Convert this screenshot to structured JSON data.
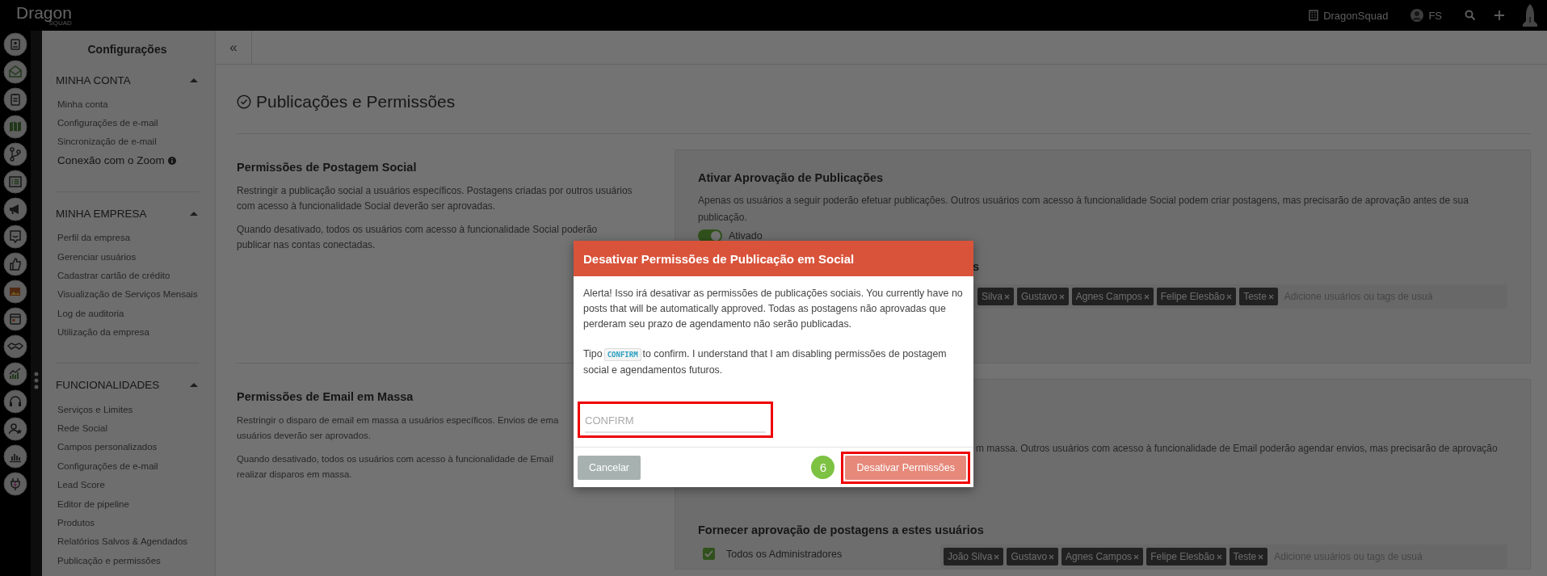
{
  "topbar": {
    "logo": {
      "word": "Dragon",
      "sub": "SQUAD"
    },
    "company": "DragonSquad",
    "user_initials": "FS"
  },
  "settings_nav": {
    "title": "Configurações",
    "sections": [
      {
        "heading": "MINHA CONTA",
        "expanded": true,
        "items": [
          {
            "label": "Minha conta",
            "kind": "link"
          },
          {
            "label": "Configurações de e-mail",
            "kind": "link"
          },
          {
            "label": "Sincronização de e-mail",
            "kind": "link"
          },
          {
            "label": "Conexão com o Zoom",
            "kind": "info"
          }
        ]
      },
      {
        "heading": "MINHA EMPRESA",
        "expanded": true,
        "items": [
          {
            "label": "Perfil da empresa",
            "kind": "link"
          },
          {
            "label": "Gerenciar usuários",
            "kind": "link"
          },
          {
            "label": "Cadastrar cartão de crédito",
            "kind": "link"
          },
          {
            "label": "Visualização de Serviços Mensais",
            "kind": "link"
          },
          {
            "label": "Log de auditoria",
            "kind": "link"
          },
          {
            "label": "Utilização da empresa",
            "kind": "link"
          }
        ]
      },
      {
        "heading": "FUNCIONALIDADES",
        "expanded": true,
        "items": [
          {
            "label": "Serviços e Limites",
            "kind": "link"
          },
          {
            "label": "Rede Social",
            "kind": "link"
          },
          {
            "label": "Campos personalizados",
            "kind": "link"
          },
          {
            "label": "Configurações de e-mail",
            "kind": "link"
          },
          {
            "label": "Lead Score",
            "kind": "link"
          },
          {
            "label": "Editor de pipeline",
            "kind": "link"
          },
          {
            "label": "Produtos",
            "kind": "link"
          },
          {
            "label": "Relatórios Salvos & Agendados",
            "kind": "link"
          },
          {
            "label": "Publicação e permissões",
            "kind": "link"
          }
        ]
      }
    ]
  },
  "collapse": "«",
  "page": {
    "title": "Publicações e Permissões",
    "sections": [
      {
        "heading": "Permissões de Postagem Social",
        "paragraphs": [
          [
            "Restringir a publicação social a usuários específicos. Postagens criadas por outros usuários",
            "com acesso à funcionalidade Social deverão ser aprovadas."
          ],
          [
            "Quando desativado, todos os usuários com acesso à funcionalidade Social poderão",
            "publicar nas contas conectadas."
          ]
        ],
        "panel": {
          "heading": "Ativar Aprovação de Publicações",
          "description": "Apenas os usuários a seguir poderão efetuar publicações. Outros usuários com acesso à funcionalidade Social podem criar postagens, mas precisarão de aprovação antes de sua publicação.",
          "toggle": {
            "label": "Ativado",
            "on": true
          },
          "approvers": {
            "heading": "s",
            "tags": [
              "Silva",
              "Gustavo",
              "Agnes Campos",
              "Felipe Elesbão",
              "Teste"
            ],
            "placeholder": "Adicione usuários ou tags de usuá"
          }
        }
      },
      {
        "heading": "Permissões de Email em Massa",
        "paragraphs": [
          [
            "Restringir o disparo de email em massa a usuários específicos. Envios de ema",
            "usuários deverão ser aprovados."
          ],
          [
            "Quando desativado, todos os usuários com acesso à funcionalidade de Email",
            "realizar disparos em massa."
          ]
        ],
        "panel": {
          "description": "m massa. Outros usuários com acesso à funcionalidade de Email poderão agendar envios, mas precisarão de aprovação",
          "approvers": {
            "heading": "Fornecer aprovação de postagens a estes usuários",
            "admins": {
              "label": "Todos os Administradores",
              "checked": true
            },
            "tags": [
              "João Silva",
              "Gustavo",
              "Agnes Campos",
              "Felipe Elesbão",
              "Teste"
            ],
            "placeholder": "Adicione usuários ou tags de usuá"
          }
        }
      }
    ]
  },
  "modal": {
    "title": "Desativar Permissões de Publicação em Social",
    "message": "Alerta! Isso irá desativar as permissões de publicações sociais. You currently have no posts that will be automatically approved. Todas as postagens não aprovadas que perderam seu prazo de agendamento não serão publicadas.",
    "instruction": {
      "before": "Tipo",
      "code": "CONFIRM",
      "after": "to confirm. I understand that I am disabling permissões de postagem social e agendamentos futuros."
    },
    "input": {
      "placeholder": "CONFIRM",
      "highlighted": true
    },
    "buttons": [
      {
        "label": "Cancelar",
        "kind": "secondary",
        "disabled": false,
        "highlighted": false
      },
      {
        "label": "Desativar Permissões",
        "kind": "danger",
        "disabled": true,
        "highlighted": true,
        "step": "6"
      }
    ]
  }
}
